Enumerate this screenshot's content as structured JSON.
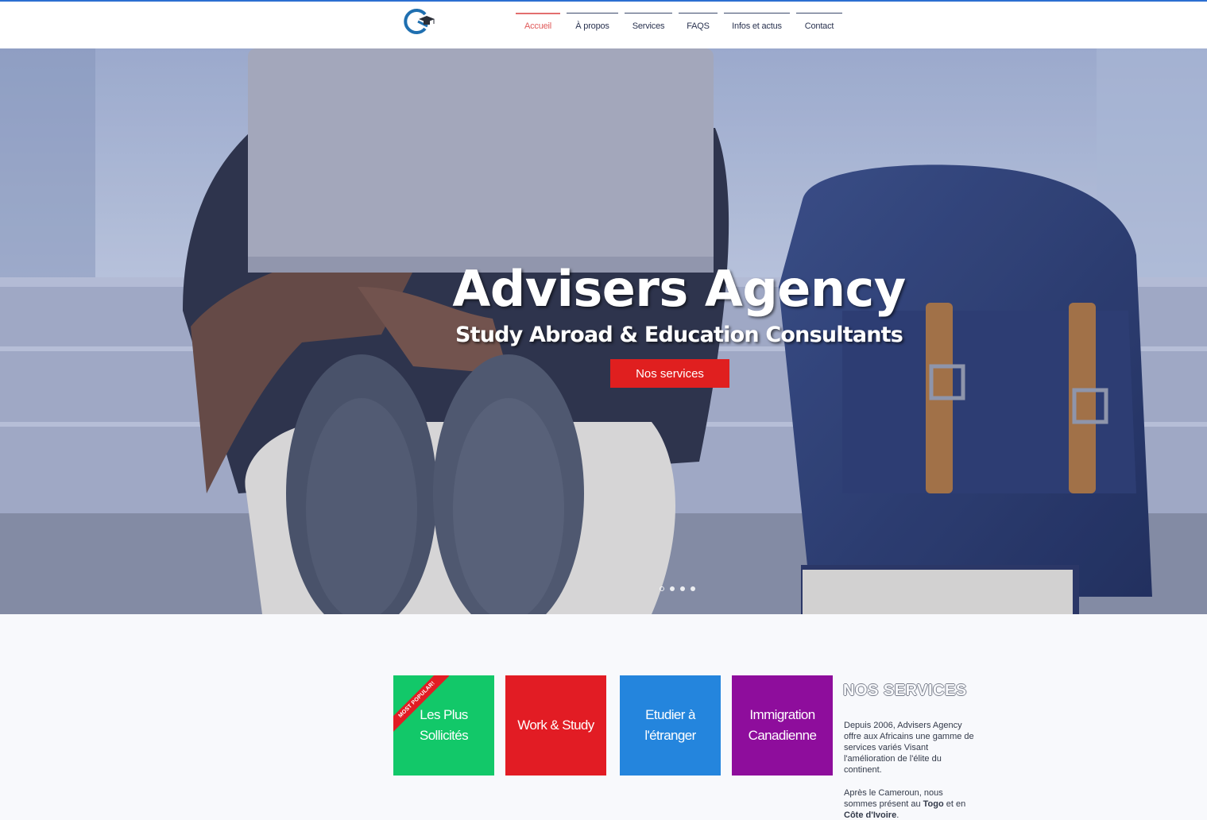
{
  "nav": {
    "items": [
      {
        "label": "Accueil",
        "active": true
      },
      {
        "label": "À propos"
      },
      {
        "label": "Services"
      },
      {
        "label": "FAQS"
      },
      {
        "label": "Infos et actus"
      },
      {
        "label": "Contact"
      }
    ]
  },
  "hero": {
    "title": "Advisers Agency",
    "subtitle": "Study Abroad & Education Consultants",
    "button_label": "Nos services",
    "slides_count": 4,
    "active_slide": 1
  },
  "services": {
    "tiles": [
      {
        "line1": "Les Plus",
        "line2": "Sollicités",
        "badge": "MOST POPULAR!",
        "color": "#12c869"
      },
      {
        "line1": "Work & Study",
        "line2": "",
        "color": "#e21c24"
      },
      {
        "line1": "Etudier à",
        "line2": "l'étranger",
        "color": "#2485dd"
      },
      {
        "line1": "Immigration",
        "line2": "Canadienne",
        "color": "#8e0d9c"
      }
    ],
    "heading": "NOS SERVICES",
    "p1": "Depuis 2006, Advisers Agency offre aux Africains une gamme de services variés Visant l'amélioration de l'élite du continent.",
    "p2_prefix": "Après le Cameroun, nous sommes présent au ",
    "p2_togo": "Togo",
    "p2_mid": " et en ",
    "p2_ci": "Côte d'Ivoire",
    "p2_end": "."
  },
  "colors": {
    "accent_red": "#e01f1f",
    "nav_active": "#e05a5a",
    "header_line": "#2b6fd1"
  }
}
